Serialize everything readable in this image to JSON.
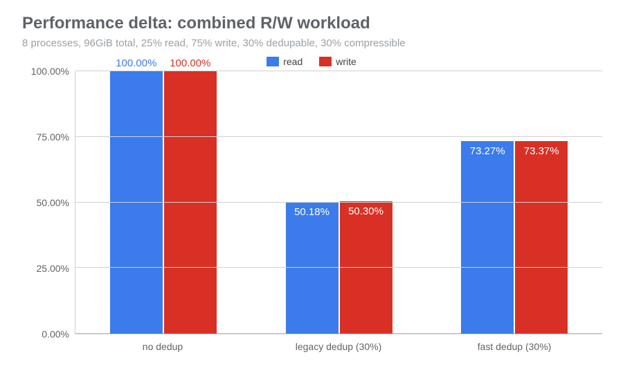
{
  "chart_data": {
    "type": "bar",
    "title": "Performance delta: combined R/W workload",
    "subtitle": "8 processes, 96GiB total, 25% read, 75% write, 30% dedupable, 30% compressible",
    "categories": [
      "no dedup",
      "legacy dedup (30%)",
      "fast dedup (30%)"
    ],
    "series": [
      {
        "name": "read",
        "color": "#3b7bec",
        "values": [
          100.0,
          50.18,
          73.27
        ],
        "label_inside": [
          false,
          true,
          true
        ]
      },
      {
        "name": "write",
        "color": "#d93025",
        "values": [
          100.0,
          50.3,
          73.37
        ],
        "label_inside": [
          false,
          true,
          true
        ]
      }
    ],
    "y_ticks": [
      0.0,
      25.0,
      50.0,
      75.0,
      100.0
    ],
    "ylim": [
      0,
      100
    ],
    "y_format_suffix": "%",
    "legend_position": "top"
  }
}
